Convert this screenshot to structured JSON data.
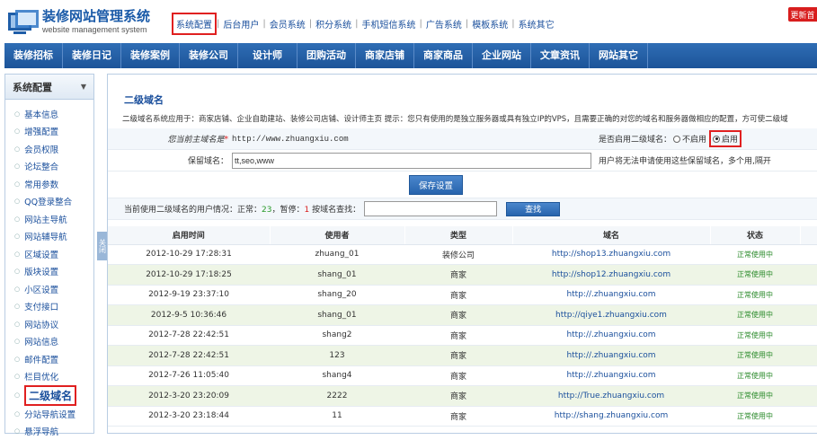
{
  "app": {
    "title": "装修网站管理系统",
    "subtitle": "website management system"
  },
  "topnav": [
    "系统配置",
    "后台用户",
    "会员系统",
    "积分系统",
    "手机短信系统",
    "广告系统",
    "模板系统",
    "系统其它"
  ],
  "update_button": "更新首",
  "mainnav": [
    "装修招标",
    "装修日记",
    "装修案例",
    "装修公司",
    "设计师",
    "团购活动",
    "商家店铺",
    "商家商品",
    "企业网站",
    "文章资讯",
    "网站其它"
  ],
  "sidebar": {
    "title": "系统配置",
    "items": [
      "基本信息",
      "增强配置",
      "会员权限",
      "论坛整合",
      "常用参数",
      "QQ登录整合",
      "网站主导航",
      "网站辅导航",
      "区域设置",
      "版块设置",
      "小区设置",
      "支付接口",
      "网站协议",
      "网站信息",
      "邮件配置",
      "栏目优化",
      "二级域名",
      "分站导航设置",
      "悬浮导航"
    ],
    "active": 16,
    "toggle": "关闭"
  },
  "page": {
    "title": "二级域名",
    "desc": "二级域名系统应用于：商家店铺、企业自助建站、装修公司店铺、设计师主页 提示：您只有使用的是独立服务器或具有独立IP的VPS，且需要正确的对您的域名和服务器做相应的配置，方可使二级域"
  },
  "form": {
    "main_domain_label": "您当前主域名是",
    "main_domain_value": "http://www.zhuangxiu.com",
    "enable_label": "是否启用二级域名：",
    "opt_off": "不启用",
    "opt_on": "启用",
    "reserve_label": "保留域名：",
    "reserve_value": "tt,seo,www",
    "reserve_hint": "用户将无法申请使用这些保留域名，多个用,隔开",
    "save": "保存设置",
    "status_prefix": "当前使用二级域名的用户情况：正常：",
    "normal_count": "23",
    "status_mid": "，暂停：",
    "paused_count": "1",
    "status_suffix": " 按域名查找：",
    "search": "查找"
  },
  "table": {
    "headers": [
      "启用时间",
      "使用者",
      "类型",
      "域名",
      "状态"
    ],
    "rows": [
      [
        "2012-10-29 17:28:31",
        "zhuang_01",
        "装修公司",
        "http://shop13.zhuangxiu.com",
        "正常使用中"
      ],
      [
        "2012-10-29 17:18:25",
        "shang_01",
        "商家",
        "http://shop12.zhuangxiu.com",
        "正常使用中"
      ],
      [
        "2012-9-19 23:37:10",
        "shang_20",
        "商家",
        "http://.zhuangxiu.com",
        "正常使用中"
      ],
      [
        "2012-9-5 10:36:46",
        "shang_01",
        "商家",
        "http://qiye1.zhuangxiu.com",
        "正常使用中"
      ],
      [
        "2012-7-28 22:42:51",
        "shang2",
        "商家",
        "http://.zhuangxiu.com",
        "正常使用中"
      ],
      [
        "2012-7-28 22:42:51",
        "123",
        "商家",
        "http://.zhuangxiu.com",
        "正常使用中"
      ],
      [
        "2012-7-26 11:05:40",
        "shang4",
        "商家",
        "http://.zhuangxiu.com",
        "正常使用中"
      ],
      [
        "2012-3-20 23:20:09",
        "2222",
        "商家",
        "http://True.zhuangxiu.com",
        "正常使用中"
      ],
      [
        "2012-3-20 23:18:44",
        "11",
        "商家",
        "http://shang.zhuangxiu.com",
        "正常使用中"
      ]
    ]
  }
}
